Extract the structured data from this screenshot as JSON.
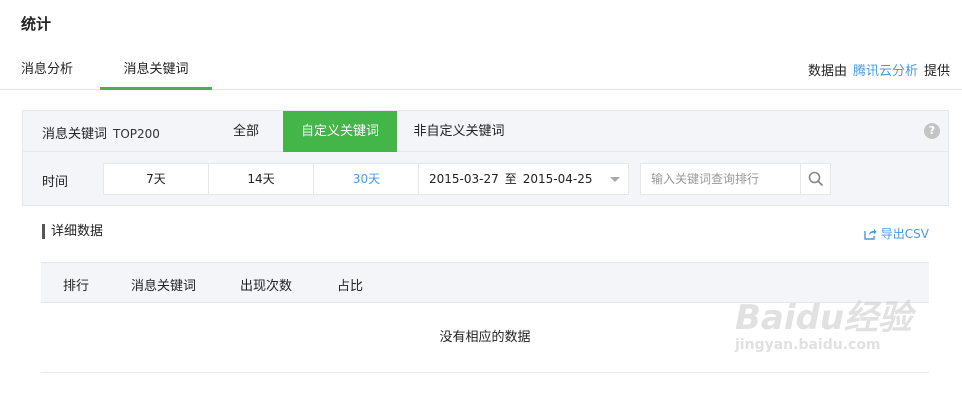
{
  "page": {
    "title": "统计"
  },
  "tabs": [
    {
      "label": "消息分析",
      "active": false
    },
    {
      "label": "消息关键词",
      "active": true
    }
  ],
  "provider": {
    "prefix": "数据由",
    "link": "腾讯云分析",
    "suffix": "提供"
  },
  "filters": {
    "keyword_label": "消息关键词",
    "keyword_sub": "TOP200",
    "keyword_types": [
      "全部",
      "自定义关键词",
      "非自定义关键词"
    ],
    "keyword_type_selected": "自定义关键词",
    "help_icon": "?",
    "time_label": "时间",
    "ranges": [
      "7天",
      "14天",
      "30天"
    ],
    "range_selected": "30天",
    "date_from": "2015-03-27",
    "date_to_label": "至",
    "date_to": "2015-04-25",
    "search_placeholder": "输入关键词查询排行"
  },
  "detail": {
    "title": "详细数据",
    "export_label": "导出CSV",
    "columns": [
      "排行",
      "消息关键词",
      "出现次数",
      "占比"
    ],
    "empty_text": "没有相应的数据"
  },
  "watermark": {
    "main": "Baidu经验",
    "sub": "jingyan.baidu.com"
  },
  "colors": {
    "accent": "#44b549",
    "link": "#459ae9",
    "panel_bg": "#f4f5f9",
    "border": "#e4e8eb"
  }
}
